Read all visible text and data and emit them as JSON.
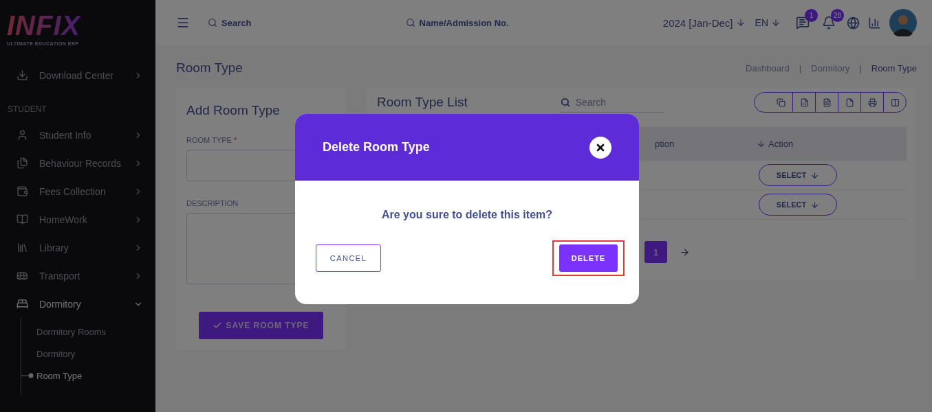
{
  "sidebar": {
    "logo": {
      "title": "INFIX",
      "subtitle": "ULTIMATE EDUCATION ERP"
    },
    "top_items": [
      {
        "label": "Download Center",
        "kind": "download",
        "expanded": false
      }
    ],
    "section_title": "STUDENT",
    "items": [
      {
        "label": "Student Info",
        "kind": "user",
        "expanded": false
      },
      {
        "label": "Behaviour Records",
        "kind": "files",
        "expanded": false
      },
      {
        "label": "Fees Collection",
        "kind": "wallet",
        "expanded": false
      },
      {
        "label": "HomeWork",
        "kind": "book",
        "expanded": false
      },
      {
        "label": "Library",
        "kind": "library",
        "expanded": false
      },
      {
        "label": "Transport",
        "kind": "bus",
        "expanded": false
      },
      {
        "label": "Dormitory",
        "kind": "bed",
        "expanded": true,
        "children": [
          {
            "label": "Dormitory Rooms",
            "selected": false
          },
          {
            "label": "Dormitory",
            "selected": false
          },
          {
            "label": "Room Type",
            "selected": true
          }
        ]
      }
    ]
  },
  "topbar": {
    "search": {
      "placeholder": "Search"
    },
    "student_search": {
      "placeholder": "Name/Admission No."
    },
    "session": "2024 [Jan-Dec]",
    "language": "EN",
    "message_count": "1",
    "notification_count": "28"
  },
  "page": {
    "title": "Room Type",
    "separator": "|",
    "breadcrumbs": [
      {
        "label": "Dashboard",
        "selected": false
      },
      {
        "label": "Dormitory",
        "selected": false
      },
      {
        "label": "Room Type",
        "selected": true
      }
    ]
  },
  "add_form": {
    "title": "Add Room Type",
    "fields": [
      {
        "label": "ROOM TYPE",
        "required_mark": "*",
        "kind": "input"
      },
      {
        "label": "DESCRIPTION",
        "kind": "textarea"
      }
    ],
    "submit": "SAVE ROOM TYPE"
  },
  "list": {
    "title": "Room Type List",
    "search": {
      "placeholder": "Search"
    },
    "columns": [
      "ption",
      "Action"
    ],
    "rows": [
      {
        "action": "SELECT"
      },
      {
        "action": "SELECT"
      }
    ],
    "pages": [
      {
        "label": "1",
        "selected": true
      }
    ]
  },
  "modal": {
    "title": "Delete Room Type",
    "message": "Are you sure to delete this item?",
    "cancel": "CANCEL",
    "delete": "DELETE",
    "delete_highlighted": true
  }
}
